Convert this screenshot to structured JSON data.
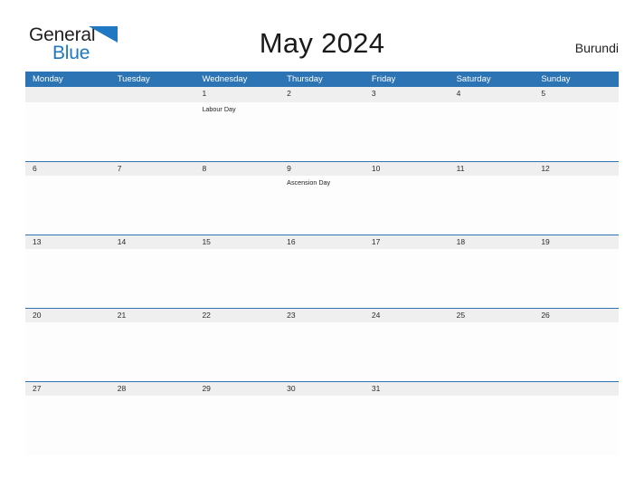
{
  "brand": {
    "name_part1": "General",
    "name_part2": "Blue",
    "flag_icon": "blue-triangle-flag-icon",
    "color_dark": "#231f20",
    "color_blue": "#1f78c1"
  },
  "header": {
    "title": "May 2024",
    "country": "Burundi"
  },
  "calendar": {
    "accent_color": "#2c74b3",
    "band_color": "#efefef",
    "weekdays": [
      "Monday",
      "Tuesday",
      "Wednesday",
      "Thursday",
      "Friday",
      "Saturday",
      "Sunday"
    ],
    "weeks": [
      {
        "days": [
          {
            "date": "",
            "events": []
          },
          {
            "date": "",
            "events": []
          },
          {
            "date": "1",
            "events": [
              "Labour Day"
            ]
          },
          {
            "date": "2",
            "events": []
          },
          {
            "date": "3",
            "events": []
          },
          {
            "date": "4",
            "events": []
          },
          {
            "date": "5",
            "events": []
          }
        ]
      },
      {
        "days": [
          {
            "date": "6",
            "events": []
          },
          {
            "date": "7",
            "events": []
          },
          {
            "date": "8",
            "events": []
          },
          {
            "date": "9",
            "events": [
              "Ascension Day"
            ]
          },
          {
            "date": "10",
            "events": []
          },
          {
            "date": "11",
            "events": []
          },
          {
            "date": "12",
            "events": []
          }
        ]
      },
      {
        "days": [
          {
            "date": "13",
            "events": []
          },
          {
            "date": "14",
            "events": []
          },
          {
            "date": "15",
            "events": []
          },
          {
            "date": "16",
            "events": []
          },
          {
            "date": "17",
            "events": []
          },
          {
            "date": "18",
            "events": []
          },
          {
            "date": "19",
            "events": []
          }
        ]
      },
      {
        "days": [
          {
            "date": "20",
            "events": []
          },
          {
            "date": "21",
            "events": []
          },
          {
            "date": "22",
            "events": []
          },
          {
            "date": "23",
            "events": []
          },
          {
            "date": "24",
            "events": []
          },
          {
            "date": "25",
            "events": []
          },
          {
            "date": "26",
            "events": []
          }
        ]
      },
      {
        "days": [
          {
            "date": "27",
            "events": []
          },
          {
            "date": "28",
            "events": []
          },
          {
            "date": "29",
            "events": []
          },
          {
            "date": "30",
            "events": []
          },
          {
            "date": "31",
            "events": []
          },
          {
            "date": "",
            "events": []
          },
          {
            "date": "",
            "events": []
          }
        ]
      }
    ]
  }
}
